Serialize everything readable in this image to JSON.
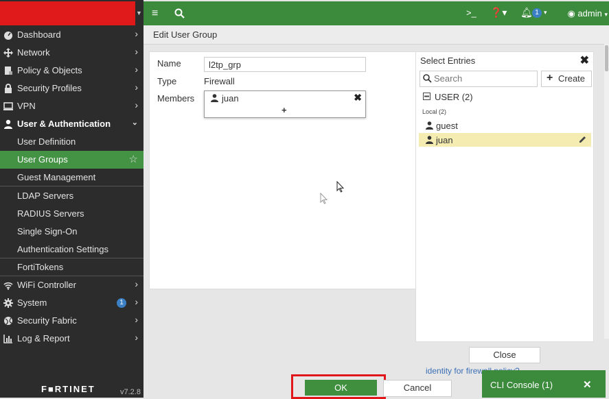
{
  "sidebar": {
    "items": [
      {
        "label": "Dashboard",
        "icon": "dashboard-icon"
      },
      {
        "label": "Network",
        "icon": "network-icon"
      },
      {
        "label": "Policy & Objects",
        "icon": "policy-icon"
      },
      {
        "label": "Security Profiles",
        "icon": "lock-icon"
      },
      {
        "label": "VPN",
        "icon": "monitor-icon"
      },
      {
        "label": "User & Authentication",
        "icon": "user-icon"
      },
      {
        "label": "User Definition"
      },
      {
        "label": "User Groups"
      },
      {
        "label": "Guest Management"
      },
      {
        "label": "LDAP Servers"
      },
      {
        "label": "RADIUS Servers"
      },
      {
        "label": "Single Sign-On"
      },
      {
        "label": "Authentication Settings"
      },
      {
        "label": "FortiTokens"
      },
      {
        "label": "WiFi Controller",
        "icon": "wifi-icon"
      },
      {
        "label": "System",
        "icon": "gear-icon",
        "badge": "1"
      },
      {
        "label": "Security Fabric",
        "icon": "fabric-icon"
      },
      {
        "label": "Log & Report",
        "icon": "chart-icon"
      }
    ],
    "footer_brand": "F■RTINET",
    "version": "v7.2.8"
  },
  "topbar": {
    "user": "admin",
    "notification_count": "1"
  },
  "page": {
    "title": "Edit User Group"
  },
  "form": {
    "name_label": "Name",
    "name_value": "l2tp_grp",
    "type_label": "Type",
    "type_value": "Firewall",
    "members_label": "Members",
    "member": "juan",
    "add_glyph": "+"
  },
  "select_entries": {
    "title": "Select Entries",
    "search_placeholder": "Search",
    "create_label": "Create",
    "group_label": "USER (2)",
    "sub_label": "Local (2)",
    "entries": [
      "guest",
      "juan"
    ],
    "close_label": "Close"
  },
  "footer": {
    "partial_link": "identity for firewall policy?",
    "ok_label": "OK",
    "cancel_label": "Cancel",
    "cli_label": "CLI Console (1)"
  },
  "colors": {
    "accent_green": "#3c8a3c",
    "brand_red": "#e01a1a",
    "highlight_frame": "#e0161b",
    "selected_row": "#f4ecb0"
  }
}
